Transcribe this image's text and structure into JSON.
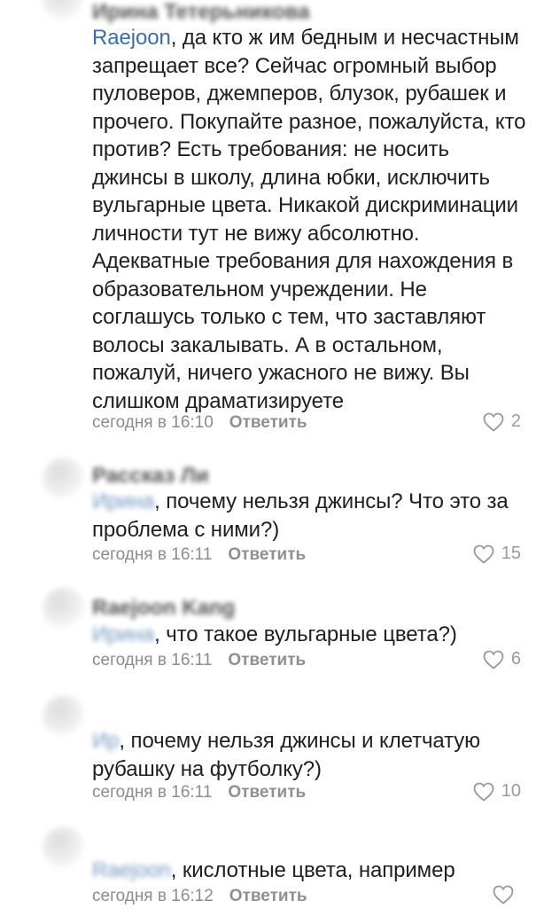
{
  "comments": [
    {
      "author": "Ирина Тетерьникова",
      "mention": "Raejoon",
      "text": ", да кто ж им бедным и несчастным запрещает все? Сейчас огромный выбор пуловеров, джемперов, блузок, рубашек и прочего. Покупайте разное, пожалуйста, кто против? Есть требования: не носить джинсы в школу, длина юбки, исключить вульгарные цвета. Никакой дискриминации личности тут не вижу абсолютно. Адекватные требования для нахождения в образовательном учреждении. Не соглашусь только с тем, что заставляют волосы закалывать. А в остальном, пожалуй, ничего ужасного не вижу. Вы слишком драматизируете",
      "time": "сегодня в 16:10",
      "reply": "Ответить",
      "likes": "2"
    },
    {
      "author": "Рассказ Ли",
      "mention": "Ирина",
      "text": ", почему нельзя джинсы? Что это за проблема с ними?)",
      "time": "сегодня в 16:11",
      "reply": "Ответить",
      "likes": "15"
    },
    {
      "author": "Raejoon Kang",
      "mention": "Ирина",
      "text": ", что такое вульгарные цвета?)",
      "time": "сегодня в 16:11",
      "reply": "Ответить",
      "likes": "6"
    },
    {
      "author": "",
      "mention": "Ир",
      "text": ", почему нельзя джинсы и клетчатую рубашку на футболку?)",
      "time": "сегодня в 16:11",
      "reply": "Ответить",
      "likes": "10"
    },
    {
      "author": "",
      "mention": "Raejoon",
      "text": ", кислотные цвета, например",
      "time": "сегодня в 16:12",
      "reply": "Ответить",
      "likes": ""
    }
  ],
  "icons": {
    "like": "heart-outline-icon"
  },
  "colors": {
    "text": "#1f1f1f",
    "meta": "#8c8c8c",
    "mention": "#3b6ea8",
    "background": "#ffffff"
  }
}
